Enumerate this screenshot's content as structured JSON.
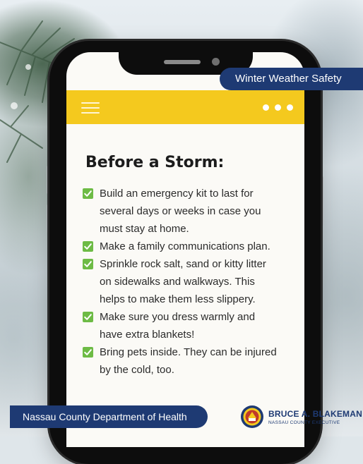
{
  "badge": {
    "label": "Winter Weather Safety"
  },
  "app_bar": {
    "menu_icon": "hamburger-menu-icon",
    "more_icon": "more-dots-icon",
    "color": "#f4c91e"
  },
  "content": {
    "title": "Before a Storm:",
    "items": [
      {
        "lines": [
          "Build an emergency kit to last for",
          "several days or weeks in case you",
          "must stay at home."
        ]
      },
      {
        "lines": [
          "Make a family communications plan."
        ]
      },
      {
        "lines": [
          "Sprinkle rock salt, sand or kitty litter",
          "on sidewalks and walkways. This",
          "helps to make them less slippery."
        ]
      },
      {
        "lines": [
          "Make sure you dress warmly and",
          "have extra blankets!"
        ]
      },
      {
        "lines": [
          "Bring pets inside. They can be injured",
          "by the cold, too."
        ]
      }
    ],
    "check_icon": "checkbox-checked-icon",
    "check_color": "#6dbb45"
  },
  "footer": {
    "department": "Nassau County Department of Health",
    "executive_name": "BRUCE A. BLAKEMAN",
    "executive_title": "NASSAU COUNTY EXECUTIVE",
    "seal_icon": "county-seal-icon"
  },
  "colors": {
    "navy": "#1e3a73",
    "yellow": "#f4c91e",
    "green": "#6dbb45"
  }
}
